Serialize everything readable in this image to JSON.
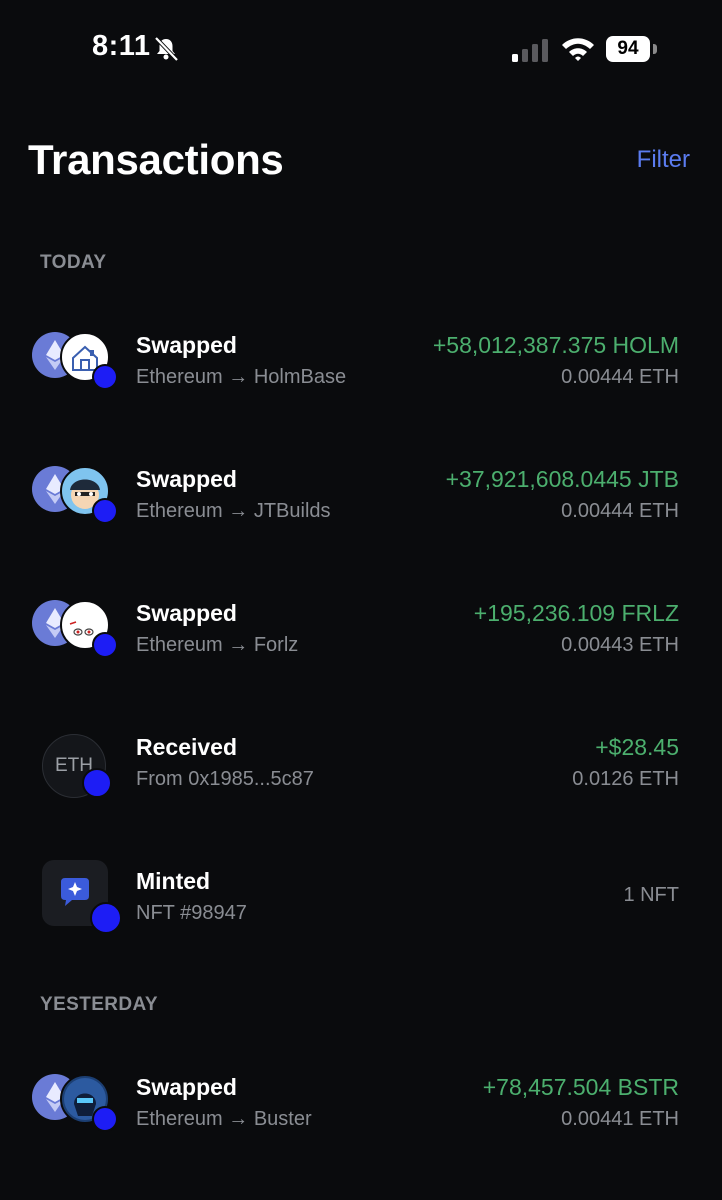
{
  "status_bar": {
    "time": "8:11",
    "battery": "94"
  },
  "header": {
    "title": "Transactions",
    "filter_label": "Filter"
  },
  "sections": [
    {
      "label": "TODAY",
      "items": [
        {
          "title": "Swapped",
          "subtitle": "Ethereum → HolmBase",
          "amount": "+58,012,387.375 HOLM",
          "secondary": "0.00444 ETH",
          "icon": "swap-eth-holmbase-icon"
        },
        {
          "title": "Swapped",
          "subtitle": "Ethereum → JTBuilds",
          "amount": "+37,921,608.0445 JTB",
          "secondary": "0.00444 ETH",
          "icon": "swap-eth-jtbuilds-icon"
        },
        {
          "title": "Swapped",
          "subtitle": "Ethereum → Forlz",
          "amount": "+195,236.109 FRLZ",
          "secondary": "0.00443 ETH",
          "icon": "swap-eth-forlz-icon"
        },
        {
          "title": "Received",
          "subtitle": "From 0x1985...5c87",
          "amount": "+$28.45",
          "secondary": "0.0126 ETH",
          "icon_label": "ETH",
          "icon": "eth-receive-icon"
        },
        {
          "title": "Minted",
          "subtitle": "NFT #98947",
          "amount": "1 NFT",
          "icon": "nft-mint-icon"
        }
      ]
    },
    {
      "label": "YESTERDAY",
      "items": [
        {
          "title": "Swapped",
          "subtitle": "Ethereum → Buster",
          "amount": "+78,457.504 BSTR",
          "secondary": "0.00441 ETH",
          "icon": "swap-eth-buster-icon"
        }
      ]
    }
  ],
  "colors": {
    "background": "#0a0b0d",
    "accent": "#5b7cf0",
    "positive": "#4caf6e",
    "muted": "#8a8d93",
    "badge": "#1d1df5",
    "eth": "#6a7bd6"
  }
}
